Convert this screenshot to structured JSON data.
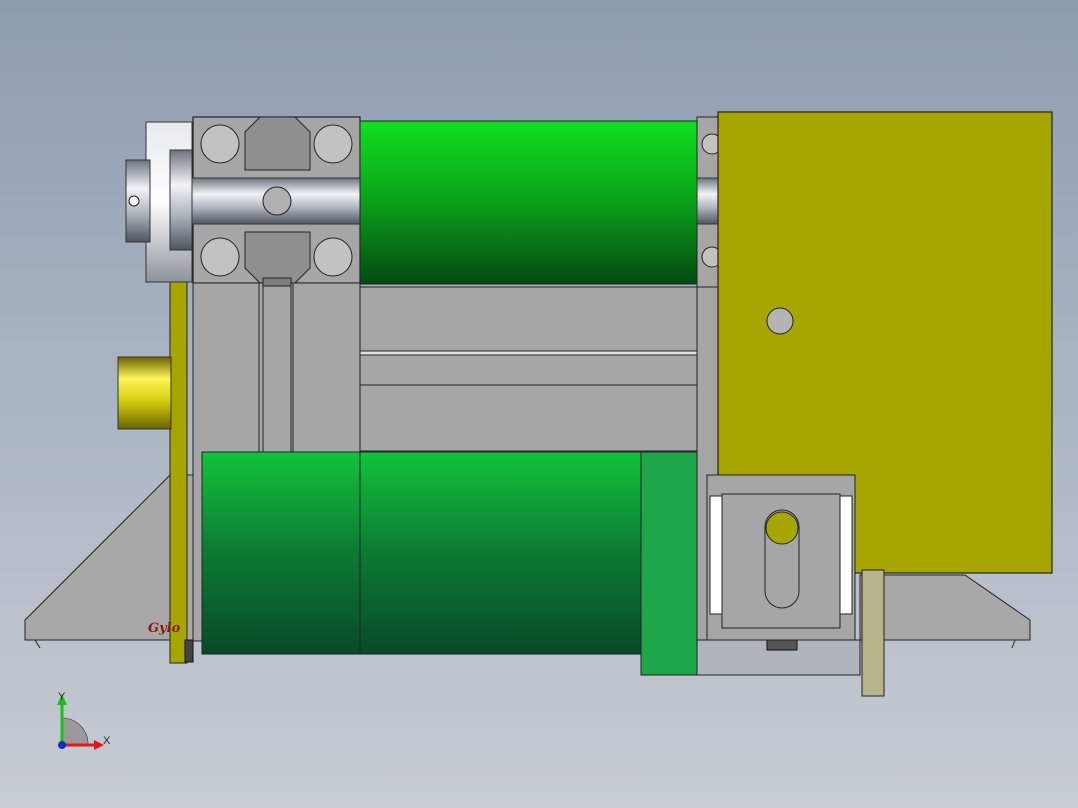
{
  "viewport": {
    "background_top": "#8e9cb0",
    "background_bottom": "#c7ccd4"
  },
  "model": {
    "logo_text": "Gylo",
    "colors": {
      "profile_gray": "#a6a6a6",
      "roller_green": "#0a8a1e",
      "bracket_olive": "#a7a600",
      "cap_yellow": "#e8e010",
      "steel": "#c8ccd2"
    },
    "icons": [
      "triad-icon"
    ]
  },
  "triad": {
    "y_label": "Y",
    "x_label": "X",
    "colors": {
      "y": "#19c219",
      "x": "#e01818",
      "z": "#1030c0"
    }
  }
}
